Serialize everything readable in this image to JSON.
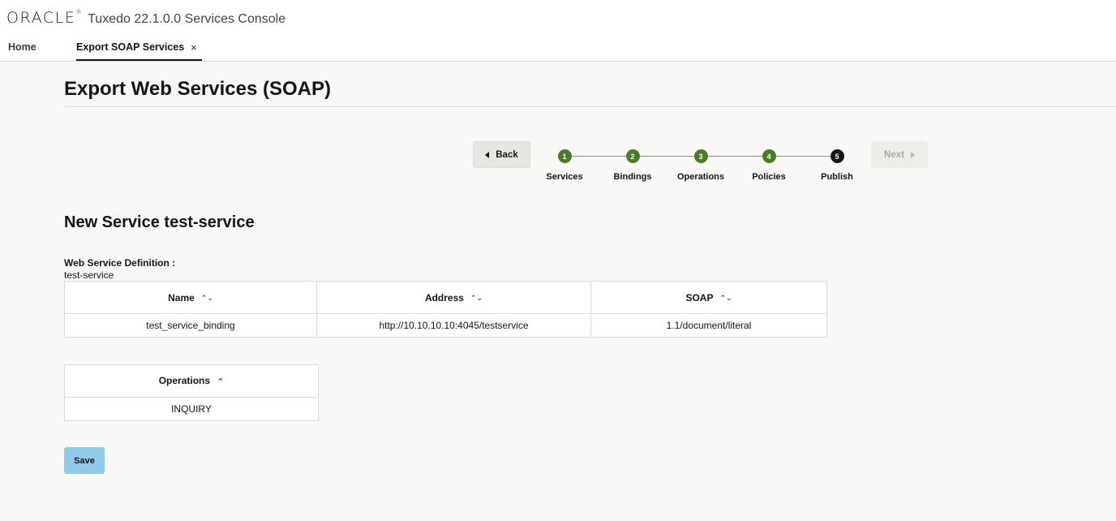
{
  "header": {
    "logo_text": "ORACLE",
    "app_title": "Tuxedo 22.1.0.0 Services Console"
  },
  "tabs": [
    {
      "label": "Home"
    },
    {
      "label": "Export SOAP Services",
      "close": "×"
    }
  ],
  "page": {
    "title": "Export Web Services (SOAP)"
  },
  "wizard": {
    "back_label": "Back",
    "next_label": "Next",
    "steps": [
      {
        "number": "1",
        "label": "Services"
      },
      {
        "number": "2",
        "label": "Bindings"
      },
      {
        "number": "3",
        "label": "Operations"
      },
      {
        "number": "4",
        "label": "Policies"
      },
      {
        "number": "5",
        "label": "Publish"
      }
    ],
    "current_step": 5
  },
  "service": {
    "heading": "New Service test-service",
    "definition_label": "Web Service Definition :",
    "definition_value": "test-service"
  },
  "bindings_table": {
    "columns": [
      "Name",
      "Address",
      "SOAP"
    ],
    "rows": [
      [
        "test_service_binding",
        "http://10.10.10.10:4045/testservice",
        "1.1/document/literal"
      ]
    ]
  },
  "operations_table": {
    "column": "Operations",
    "rows": [
      "INQUIRY"
    ]
  },
  "actions": {
    "save_label": "Save"
  },
  "colors": {
    "step_done": "#4c7a2b",
    "step_current": "#161513",
    "save_button": "#8fcbe9"
  }
}
